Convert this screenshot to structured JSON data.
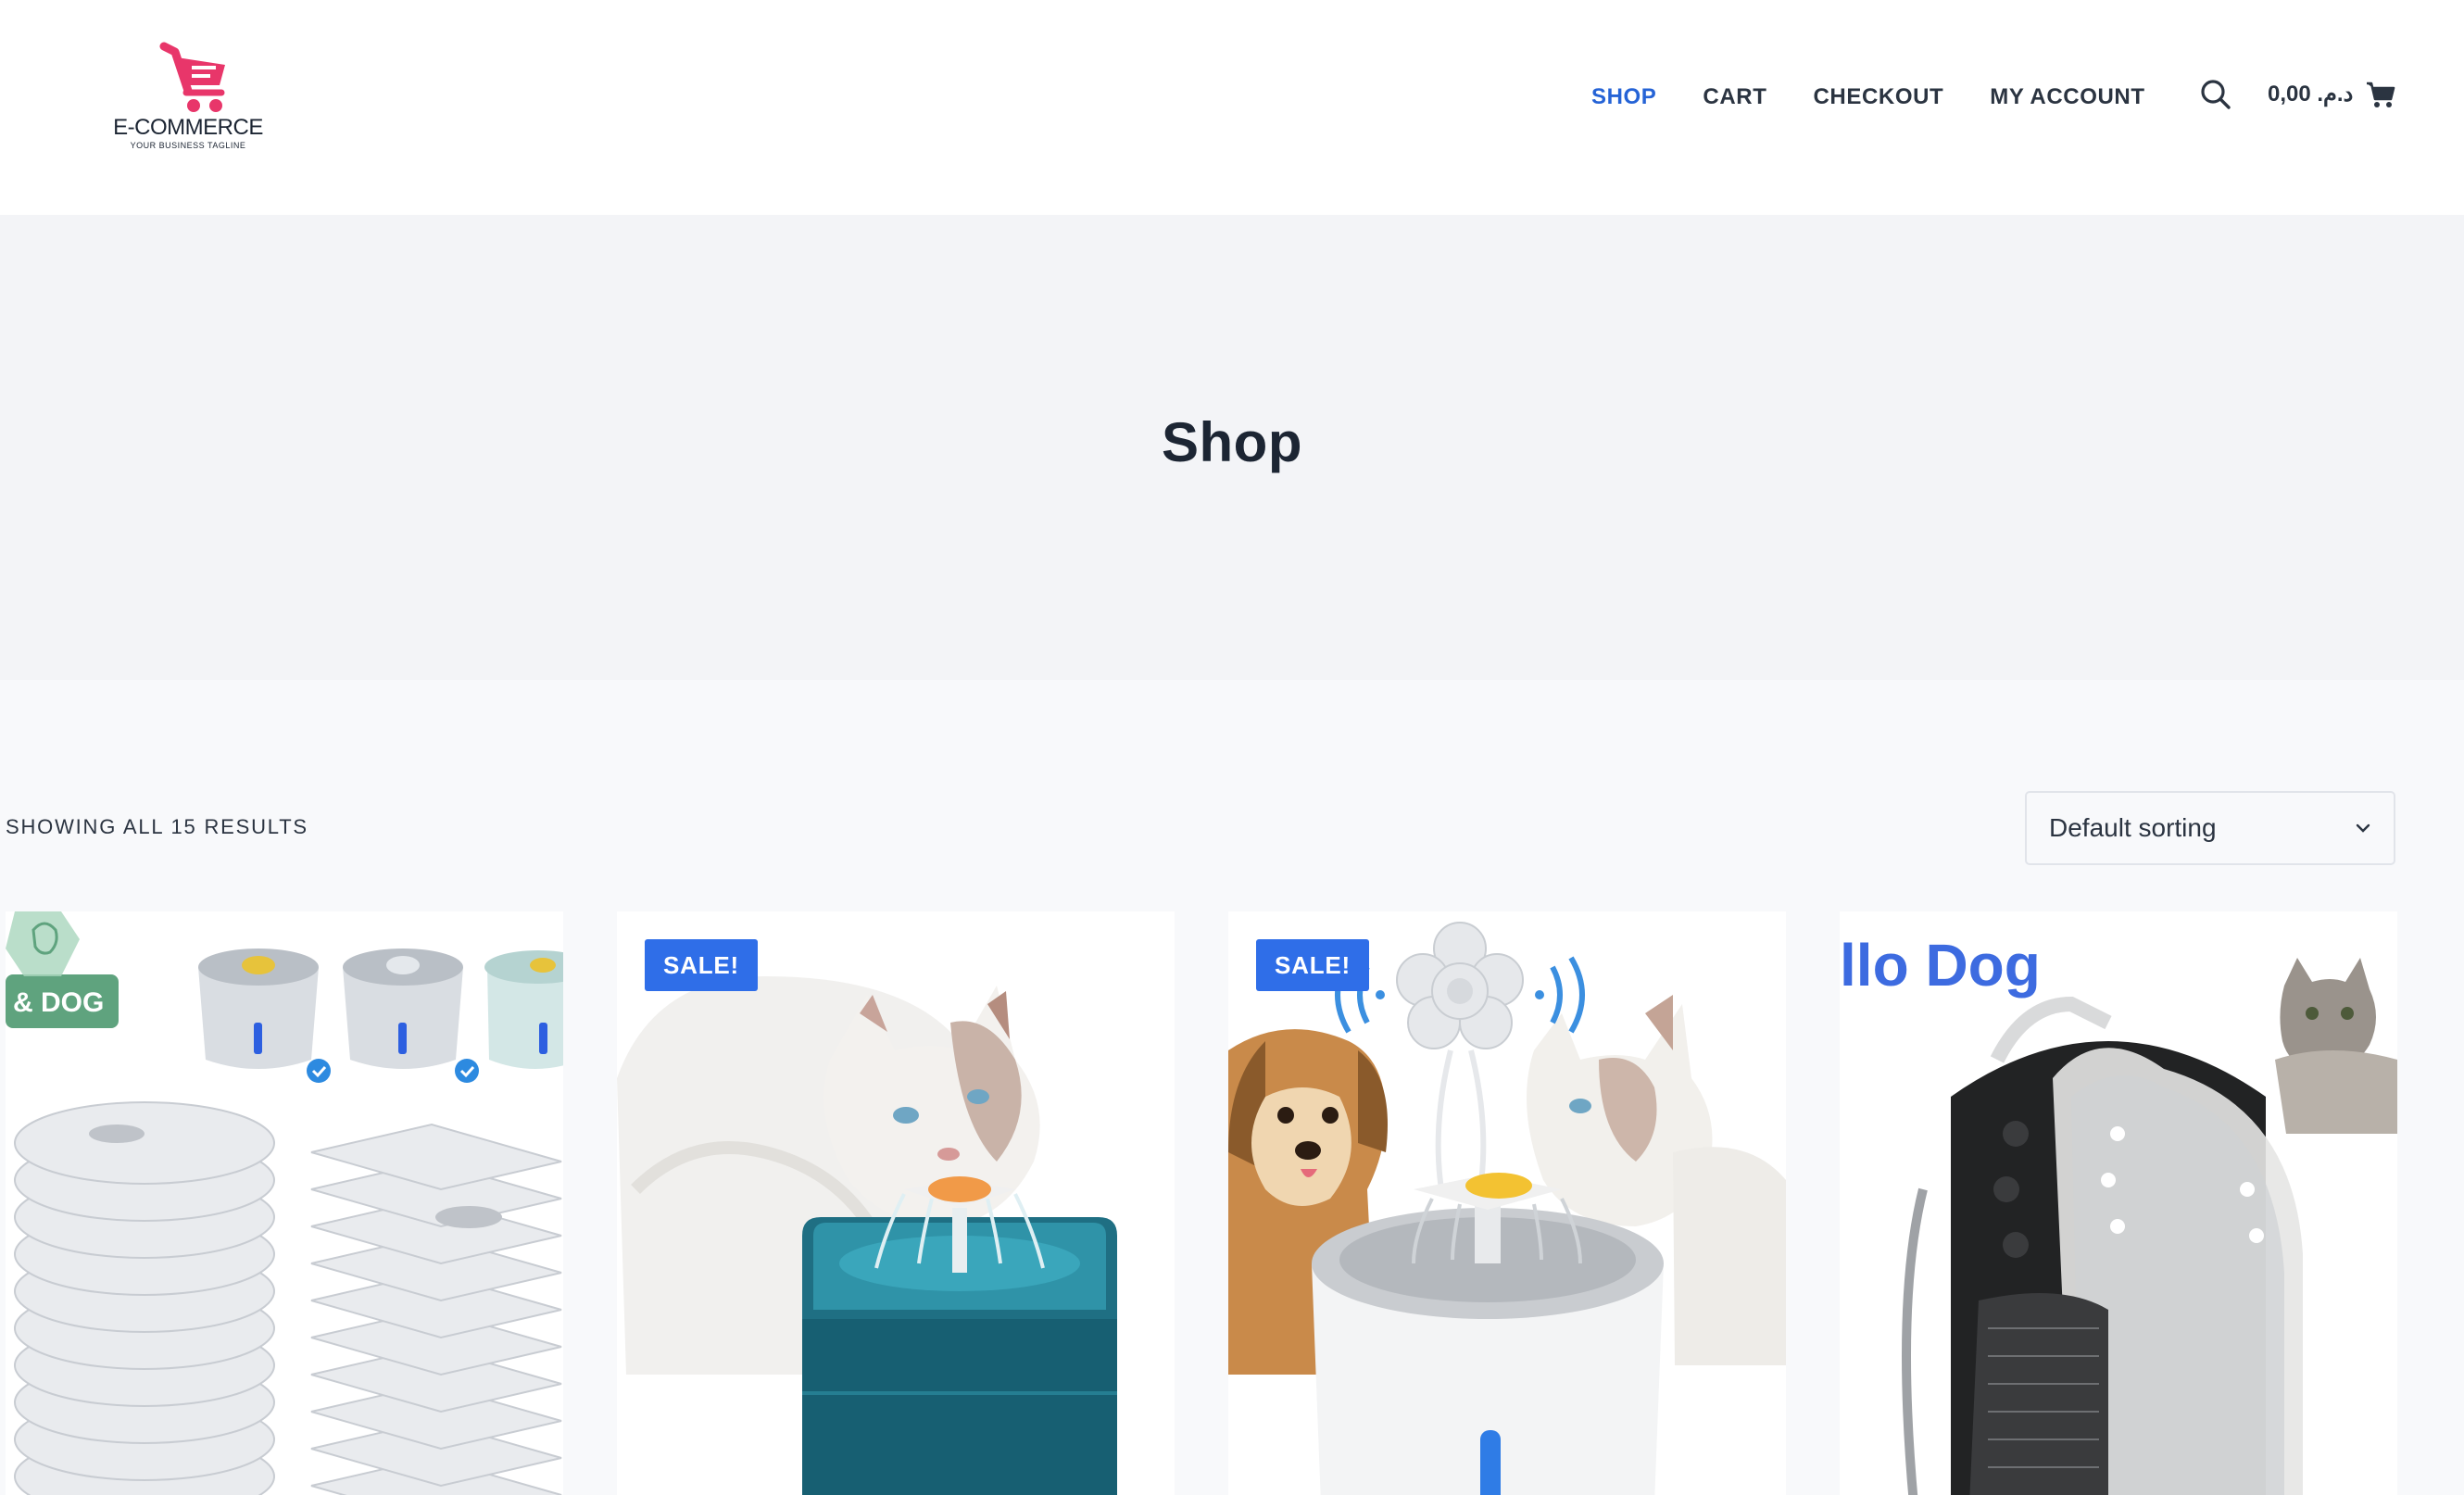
{
  "header": {
    "logo": {
      "name": "E-COMMERCE",
      "tagline": "YOUR BUSINESS TAGLINE",
      "accent_color": "#e8366a"
    },
    "nav": [
      {
        "label": "SHOP",
        "active": true
      },
      {
        "label": "CART",
        "active": false
      },
      {
        "label": "CHECKOUT",
        "active": false
      },
      {
        "label": "MY ACCOUNT",
        "active": false
      }
    ],
    "search_icon": "search-icon",
    "cart_total": "0,00 .د.م",
    "cart_icon": "cart-icon"
  },
  "hero": {
    "title": "Shop"
  },
  "toolbar": {
    "result_count": "SHOWING ALL 15 RESULTS",
    "sort_selected": "Default sorting",
    "sort_icon": "chevron-down-icon"
  },
  "products": [
    {
      "badge": "",
      "image_text": "& DOG",
      "image": "fountain-filters"
    },
    {
      "badge": "SALE!",
      "image_text": "",
      "image": "cat-drinking-fountain"
    },
    {
      "badge": "SALE!",
      "image_text": "",
      "image": "dog-cat-fountain-sensor"
    },
    {
      "badge": "",
      "image_text": "llo Dog",
      "image": "pet-backpack"
    }
  ],
  "colors": {
    "accent": "#2563d6",
    "badge": "#2f6ee8",
    "hero_bg": "#f3f4f7"
  }
}
